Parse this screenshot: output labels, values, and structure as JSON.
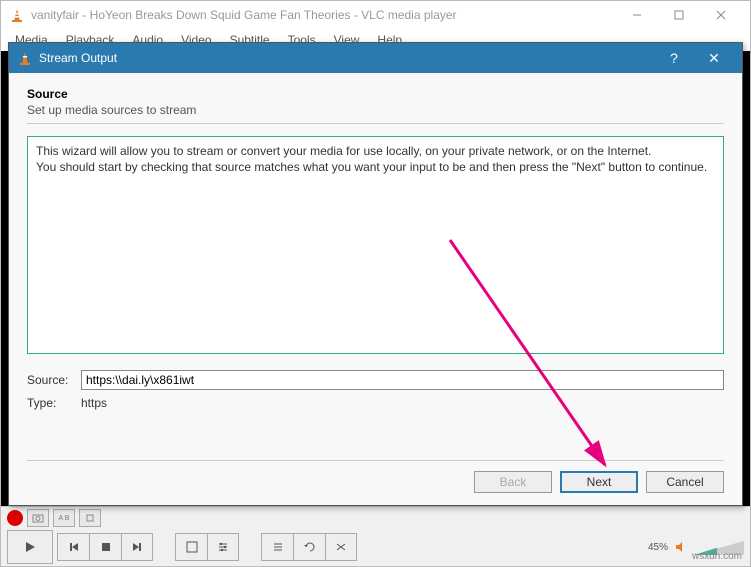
{
  "main_window": {
    "title": "vanityfair - HoYeon Breaks Down Squid Game Fan Theories - VLC media player",
    "menu": [
      "Media",
      "Playback",
      "Audio",
      "Video",
      "Subtitle",
      "Tools",
      "View",
      "Help"
    ],
    "volume_pct": "45%"
  },
  "dialog": {
    "title": "Stream Output",
    "section_title": "Source",
    "section_sub": "Set up media sources to stream",
    "wizard_line1": "This wizard will allow you to stream or convert your media for use locally, on your private network, or on the Internet.",
    "wizard_line2": "You should start by checking that source matches what you want your input to be and then press the \"Next\" button to continue.",
    "source_label": "Source:",
    "source_value": "https:\\\\dai.ly\\x861iwt",
    "type_label": "Type:",
    "type_value": "https",
    "btn_back": "Back",
    "btn_next": "Next",
    "btn_cancel": "Cancel"
  },
  "watermark": "wsxdn.com"
}
